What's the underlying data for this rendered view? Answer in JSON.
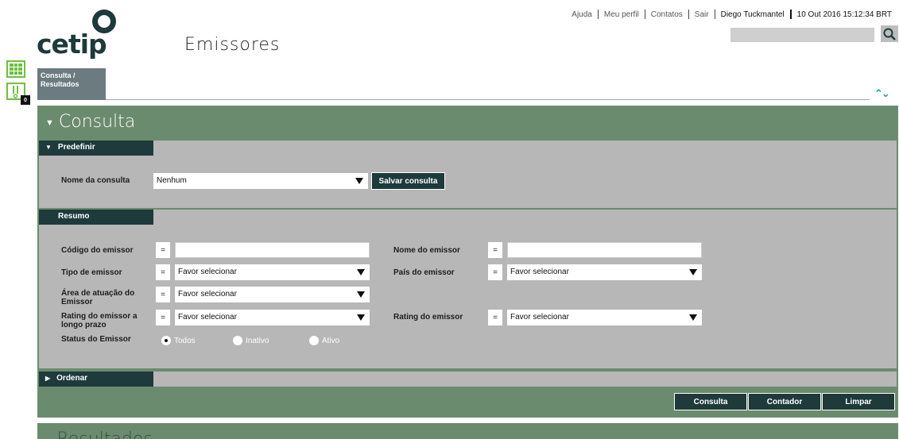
{
  "header": {
    "logo_text": "cetip",
    "page_title": "Emissores",
    "links": [
      "Ajuda",
      "Meu perfil",
      "Contatos",
      "Sair"
    ],
    "user": "Diego Tuckmantel",
    "datetime": "10 Out 2016 15:12:34 BRT",
    "search_value": ""
  },
  "side": {
    "alert_count": "0"
  },
  "tab": {
    "label_line1": "Consulta /",
    "label_line2": "Resultados"
  },
  "consulta": {
    "title": "Consulta",
    "predefinir": {
      "header": "Predefinir",
      "nome_label": "Nome da consulta",
      "nome_value": "Nenhum",
      "salvar_label": "Salvar consulta"
    },
    "resumo": {
      "header": "Resumo",
      "eq": "=",
      "codigo_label": "Código do emissor",
      "nome_emissor_label": "Nome do emissor",
      "tipo_label": "Tipo de emissor",
      "tipo_value": "Favor selecionar",
      "pais_label": "País do emissor",
      "pais_value": "Favor selecionar",
      "area_label_1": "Área de atuação do",
      "area_label_2": "Emissor",
      "area_value": "Favor selecionar",
      "rating_lp_label_1": "Rating do emissor a",
      "rating_lp_label_2": "longo prazo",
      "rating_lp_value": "Favor selecionar",
      "rating_label": "Rating do emissor",
      "rating_value": "Favor selecionar",
      "status_label": "Status do Emissor",
      "status_options": [
        "Todos",
        "Inativo",
        "Ativo"
      ]
    },
    "ordenar": {
      "header": "Ordenar"
    },
    "buttons": {
      "consulta": "Consulta",
      "contador": "Contador",
      "limpar": "Limpar"
    }
  },
  "resultados": {
    "title": "Resultados"
  }
}
